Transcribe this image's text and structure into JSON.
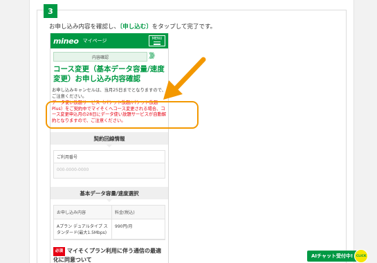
{
  "step": {
    "number": "3",
    "instruction_before": "お申し込み内容を確認し、",
    "instruction_em": "〔申し込む〕",
    "instruction_after": "をタップして完了です。"
  },
  "phone": {
    "header": {
      "logo": "mineo",
      "subtitle": "マイページ",
      "menu_label": "MENU"
    },
    "progress": {
      "label": "内容確認",
      "chevrons": "》》》"
    },
    "title": "コース変更（基本データ容量/速度変更）お申し込み内容確認",
    "cancel_note": "お申し込みキャンセルは、当月25日までとなりますので、ご注意ください。",
    "warning": "データ使い放題サービス（パケット放題/パケット放題Plus）をご契約中でマイそくへコース変更される場合、コース変更申込月の28日にデータ使い放題サービスが自動解約となりますので、ご注意ください。",
    "contract_section": {
      "title": "契約回線情報",
      "label": "ご利用番号",
      "value": "000-0000-0000"
    },
    "plan_section": {
      "title": "基本データ容量/速度選択",
      "headers": [
        "お申し込み内容",
        "料金(税込)"
      ],
      "rows": [
        [
          "Aプラン デュアルタイプ スタンダード(最大1.5Mbps)",
          "990円/月"
        ]
      ]
    },
    "consent": {
      "tag": "必須",
      "text": "マイそくプラン利用に伴う通信の最適化に同意ついて"
    }
  },
  "chat": {
    "label": "AIチャット受付中!",
    "click": "CLICK"
  },
  "colors": {
    "brand_green": "#009944",
    "highlight_orange": "#f39800",
    "warning_red": "#e60012"
  }
}
